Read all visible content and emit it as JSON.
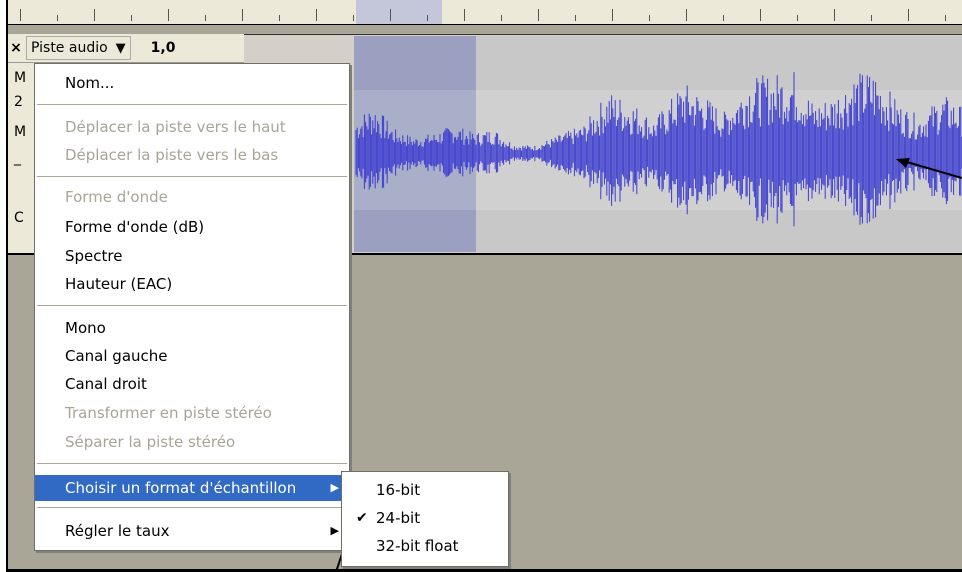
{
  "track": {
    "close_glyph": "×",
    "name": "Piste audio",
    "dropdown_glyph": "▼",
    "gain": "1,0",
    "side_labels": [
      "M",
      "2",
      "M",
      "_",
      "C"
    ]
  },
  "menu": {
    "items": [
      {
        "label": "Nom...",
        "enabled": true
      },
      {
        "label": "Déplacer la piste vers le haut",
        "enabled": false
      },
      {
        "label": "Déplacer la piste vers le bas",
        "enabled": false
      },
      {
        "label": "Forme d'onde",
        "enabled": false
      },
      {
        "label": "Forme d'onde (dB)",
        "enabled": true
      },
      {
        "label": "Spectre",
        "enabled": true
      },
      {
        "label": "Hauteur (EAC)",
        "enabled": true
      },
      {
        "label": "Mono",
        "enabled": true
      },
      {
        "label": "Canal gauche",
        "enabled": true
      },
      {
        "label": "Canal droit",
        "enabled": true
      },
      {
        "label": "Transformer en piste stéréo",
        "enabled": false
      },
      {
        "label": "Séparer la piste stéréo",
        "enabled": false
      },
      {
        "label": "Choisir un format d'échantillon",
        "enabled": true,
        "submenu_arrow": "▶"
      },
      {
        "label": "Régler le taux",
        "enabled": true,
        "submenu_arrow": "▶"
      }
    ]
  },
  "submenu": {
    "items": [
      {
        "label": "16-bit",
        "checked": false
      },
      {
        "label": "24-bit",
        "checked": true,
        "check_glyph": "✔"
      },
      {
        "label": "32-bit float",
        "checked": false
      }
    ]
  },
  "colors": {
    "waveform": "#3c3cd0",
    "selection": "#9ba0c0",
    "menu_highlight": "#316ac5",
    "background": "#a9a697"
  }
}
